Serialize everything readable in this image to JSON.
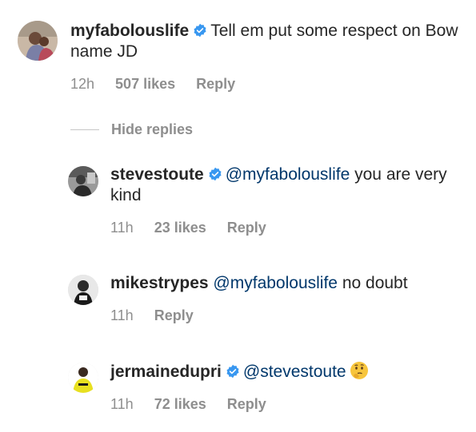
{
  "comments": [
    {
      "username": "myfabolouslife",
      "verified": true,
      "text": "Tell em put some respect on Bow name JD",
      "time": "12h",
      "likes": "507 likes",
      "reply_label": "Reply"
    }
  ],
  "hide_replies_label": "Hide replies",
  "replies": [
    {
      "username": "stevestoute",
      "verified": true,
      "mention": "@myfabolouslife",
      "text": "you are very kind",
      "time": "11h",
      "likes": "23 likes",
      "reply_label": "Reply"
    },
    {
      "username": "mikestrypes",
      "verified": false,
      "mention": "@myfabolouslife",
      "text": "no doubt",
      "time": "11h",
      "likes": "",
      "reply_label": "Reply"
    },
    {
      "username": "jermainedupri",
      "verified": true,
      "mention": "@stevestoute",
      "text": "",
      "emoji": "thinking-face",
      "time": "11h",
      "likes": "72 likes",
      "reply_label": "Reply"
    }
  ],
  "colors": {
    "text": "#262626",
    "secondary": "#8e8e8e",
    "mention": "#00376b",
    "verified": "#3897f0"
  }
}
